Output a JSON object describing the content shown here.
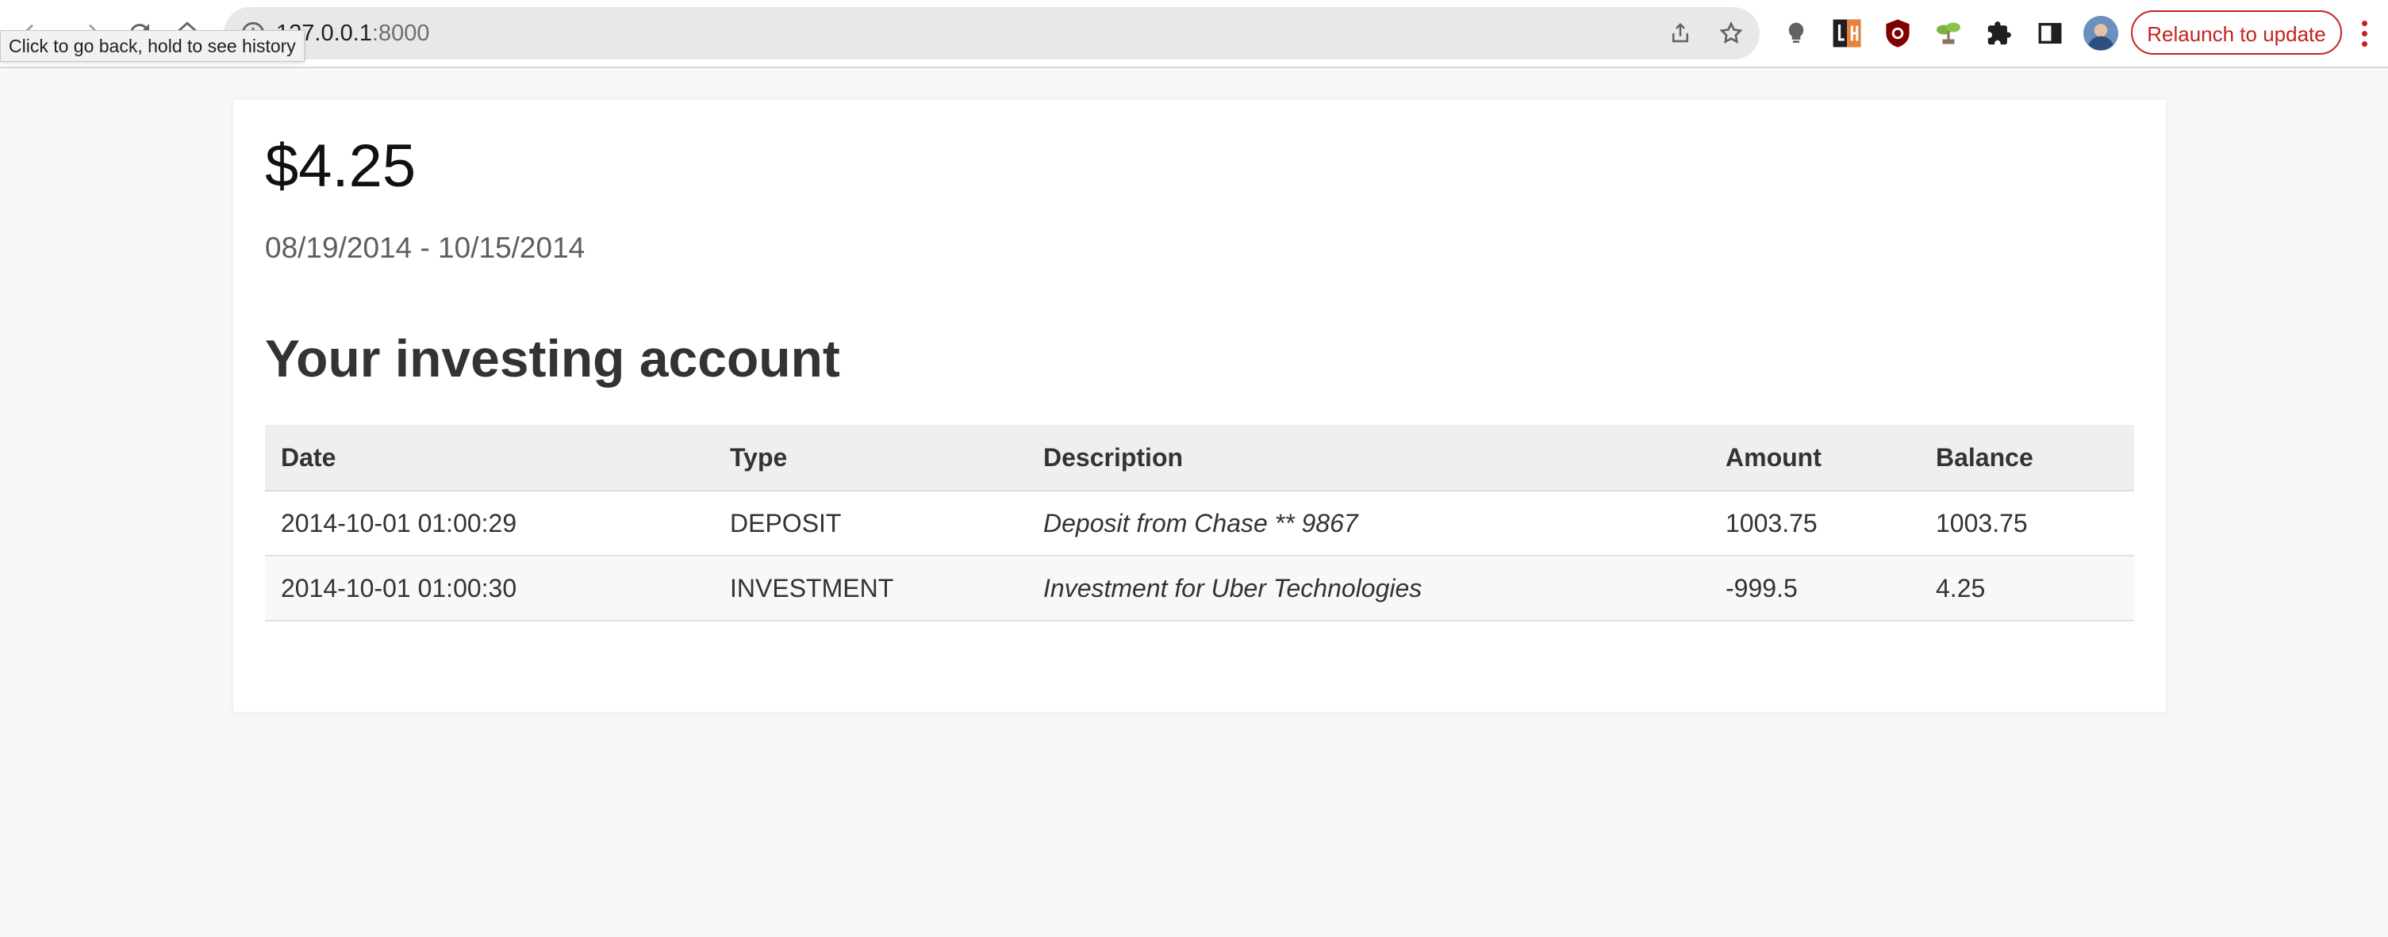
{
  "browser": {
    "address_host": "127.0.0.1",
    "address_port": ":8000",
    "back_tooltip": "Click to go back, hold to see history",
    "relaunch_label": "Relaunch to update",
    "accent_color": "#c5221f",
    "extensions": [
      "lightbulb-icon",
      "lh-icon",
      "ublock-icon",
      "bonsai-icon",
      "puzzle-icon",
      "side-panel-icon",
      "profile-avatar"
    ]
  },
  "summary": {
    "balance": "$4.25",
    "date_range": "08/19/2014 - 10/15/2014"
  },
  "account": {
    "title": "Your investing account",
    "columns": [
      "Date",
      "Type",
      "Description",
      "Amount",
      "Balance"
    ],
    "rows": [
      {
        "date": "2014-10-01 01:00:29",
        "type": "DEPOSIT",
        "description": "Deposit from Chase ** 9867",
        "amount": "1003.75",
        "balance": "1003.75"
      },
      {
        "date": "2014-10-01 01:00:30",
        "type": "INVESTMENT",
        "description": "Investment for Uber Technologies",
        "amount": "-999.5",
        "balance": "4.25"
      }
    ]
  }
}
